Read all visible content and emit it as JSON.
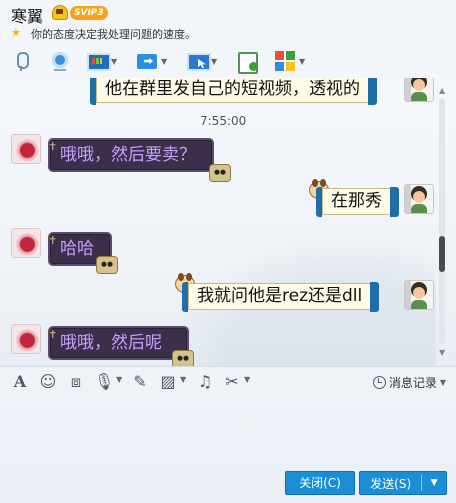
{
  "header": {
    "contact_name": "寒翼",
    "vip_badge": "SVIP3",
    "status_icon": "star-icon",
    "status_text": "你的态度决定我处理问题的速度。"
  },
  "toolbar": {
    "items": [
      {
        "name": "voice-call",
        "icon": "microphone-icon"
      },
      {
        "name": "video-call",
        "icon": "camera-icon"
      },
      {
        "name": "screen-share",
        "icon": "presentation-icon"
      },
      {
        "name": "send-file",
        "icon": "folder-arrow-icon"
      },
      {
        "name": "remote-assist",
        "icon": "remote-desktop-icon"
      },
      {
        "name": "create-note",
        "icon": "note-add-icon"
      },
      {
        "name": "apps",
        "icon": "apps-grid-icon"
      }
    ]
  },
  "chat": {
    "timestamp": "7:55:00",
    "messages": [
      {
        "side": "right",
        "text": "他在群里发自己的短视频，透视的"
      },
      {
        "side": "left",
        "text": "哦哦，然后要卖？"
      },
      {
        "side": "right",
        "text": "在那秀"
      },
      {
        "side": "left",
        "text": "哈哈"
      },
      {
        "side": "right",
        "text": "我就问他是rez还是dll"
      },
      {
        "side": "left",
        "text": "哦哦，然后呢"
      }
    ]
  },
  "input_toolbar": {
    "icons": [
      "font-icon",
      "emoji-icon",
      "screenshot-icon",
      "voice-message-icon",
      "edit-icon",
      "image-icon",
      "music-icon",
      "scissors-icon"
    ],
    "history_label": "消息记录"
  },
  "input": {
    "value": "",
    "placeholder": ""
  },
  "buttons": {
    "close_label": "关闭(C)",
    "send_label": "发送(S)"
  },
  "colors": {
    "accent": "#1a8fd8",
    "left_bubble_bg": "#3c2f4a",
    "left_bubble_text": "#c7a0ff",
    "right_bubble_bg": "#fffbe8"
  }
}
